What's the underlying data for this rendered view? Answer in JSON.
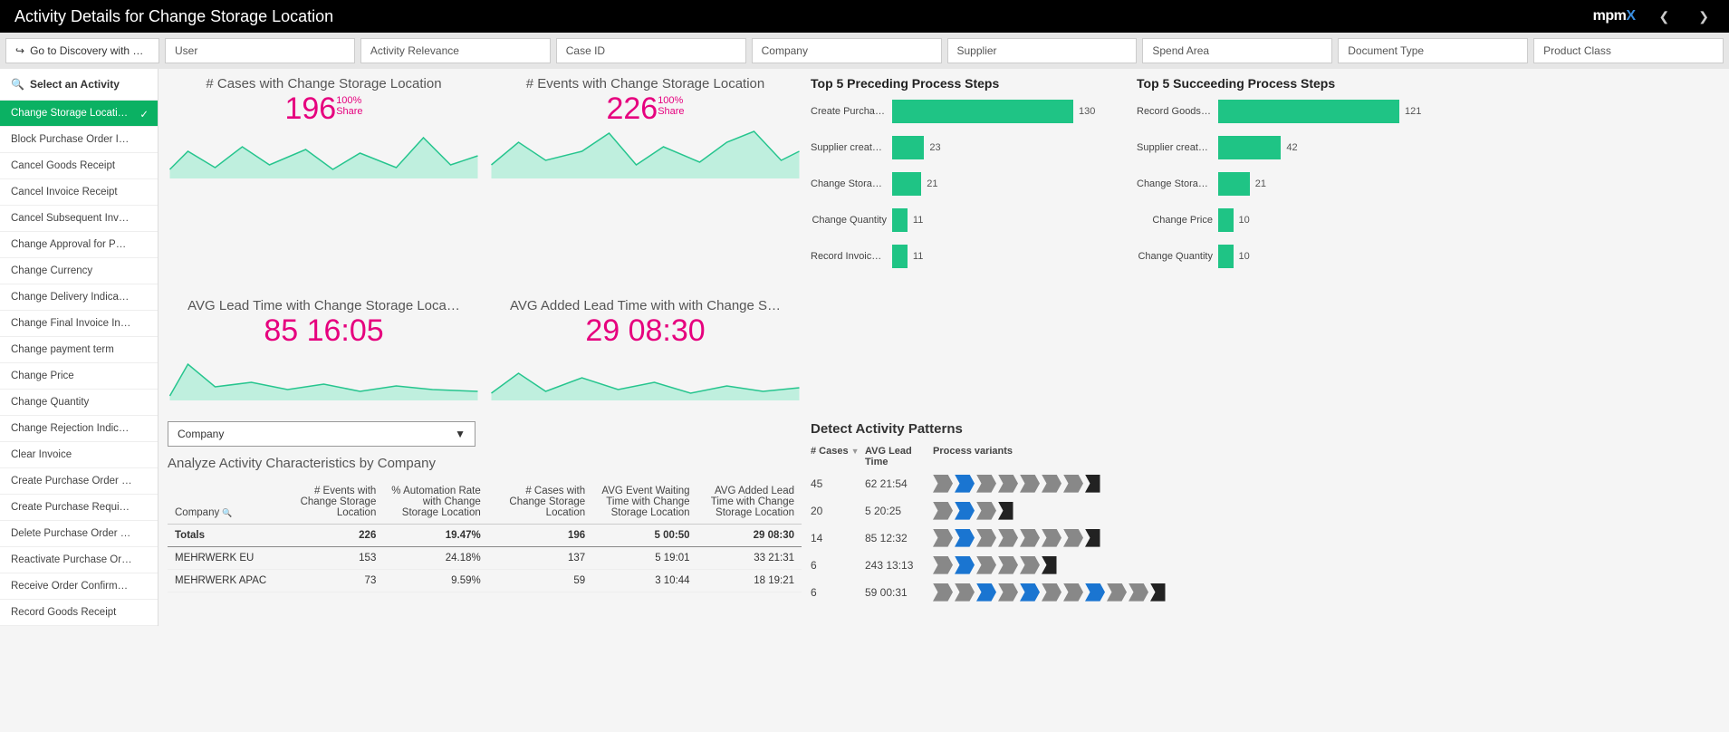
{
  "header": {
    "title": "Activity Details for Change Storage Location",
    "logo_prefix": "mpm",
    "logo_suffix": "X"
  },
  "filters": {
    "discovery": "Go to Discovery with …",
    "items": [
      "User",
      "Activity Relevance",
      "Case ID",
      "Company",
      "Supplier",
      "Spend Area",
      "Document Type",
      "Product Class"
    ]
  },
  "sidebar": {
    "title": "Select an Activity",
    "items": [
      "Change Storage Locati…",
      "Block Purchase Order I…",
      "Cancel Goods Receipt",
      "Cancel Invoice Receipt",
      "Cancel Subsequent Inv…",
      "Change Approval for P…",
      "Change Currency",
      "Change Delivery Indica…",
      "Change Final Invoice In…",
      "Change payment term",
      "Change Price",
      "Change Quantity",
      "Change Rejection Indic…",
      "Clear Invoice",
      "Create Purchase Order …",
      "Create Purchase Requi…",
      "Delete Purchase Order …",
      "Reactivate Purchase Or…",
      "Receive Order Confirm…",
      "Record Goods Receipt"
    ],
    "selected_index": 0
  },
  "kpis": [
    {
      "title": "# Cases with Change Storage Location",
      "value": "196",
      "pct": "100%",
      "sub": "Share"
    },
    {
      "title": "# Events with Change Storage Location",
      "value": "226",
      "pct": "100%",
      "sub": "Share"
    },
    {
      "title": "AVG Lead Time with Change Storage Loca…",
      "value": "85 16:05"
    },
    {
      "title": "AVG Added Lead Time with with Change S…",
      "value": "29 08:30"
    }
  ],
  "top_preceding": {
    "title": "Top 5 Preceding Process Steps",
    "max": 130,
    "items": [
      {
        "label": "Create Purchas…",
        "value": 130
      },
      {
        "label": "Supplier creates…",
        "value": 23
      },
      {
        "label": "Change Storage…",
        "value": 21
      },
      {
        "label": "Change Quantity",
        "value": 11
      },
      {
        "label": "Record Invoice …",
        "value": 11
      }
    ]
  },
  "top_succeeding": {
    "title": "Top 5 Succeeding Process Steps",
    "max": 121,
    "items": [
      {
        "label": "Record Goods R…",
        "value": 121
      },
      {
        "label": "Supplier creates…",
        "value": 42
      },
      {
        "label": "Change Storage…",
        "value": 21
      },
      {
        "label": "Change Price",
        "value": 10
      },
      {
        "label": "Change Quantity",
        "value": 10
      }
    ]
  },
  "analyze": {
    "selector": "Company",
    "title": "Analyze Activity Characteristics by Company",
    "headers": [
      "Company",
      "# Events with Change Storage Location",
      "% Automation Rate with Change Storage Location",
      "# Cases with Change Storage Location",
      "AVG Event Waiting Time with Change Storage Location",
      "AVG Added Lead Time with Change Storage Location"
    ],
    "totals": [
      "Totals",
      "226",
      "19.47%",
      "196",
      "5 00:50",
      "29 08:30"
    ],
    "rows": [
      [
        "MEHRWERK EU",
        "153",
        "24.18%",
        "137",
        "5 19:01",
        "33 21:31"
      ],
      [
        "MEHRWERK APAC",
        "73",
        "9.59%",
        "59",
        "3 10:44",
        "18 19:21"
      ]
    ]
  },
  "patterns": {
    "title": "Detect Activity Patterns",
    "headers": [
      "# Cases",
      "AVG Lead Time",
      "Process variants"
    ],
    "rows": [
      {
        "cases": "45",
        "lead": "62 21:54",
        "chev": [
          "g",
          "b",
          "g",
          "g",
          "g",
          "g",
          "g",
          "e"
        ]
      },
      {
        "cases": "20",
        "lead": "5 20:25",
        "chev": [
          "g",
          "b",
          "g",
          "e"
        ]
      },
      {
        "cases": "14",
        "lead": "85 12:32",
        "chev": [
          "g",
          "b",
          "g",
          "g",
          "g",
          "g",
          "g",
          "e"
        ]
      },
      {
        "cases": "6",
        "lead": "243 13:13",
        "chev": [
          "g",
          "b",
          "g",
          "g",
          "g",
          "e"
        ]
      },
      {
        "cases": "6",
        "lead": "59 00:31",
        "chev": [
          "g",
          "g",
          "b",
          "g",
          "b",
          "g",
          "g",
          "b",
          "g",
          "g",
          "e"
        ]
      }
    ]
  },
  "chart_data": [
    {
      "type": "bar",
      "title": "Top 5 Preceding Process Steps",
      "categories": [
        "Create Purchase Order Item",
        "Supplier creates invoice",
        "Change Storage Location",
        "Change Quantity",
        "Record Invoice Receipt"
      ],
      "values": [
        130,
        23,
        21,
        11,
        11
      ],
      "orientation": "horizontal"
    },
    {
      "type": "bar",
      "title": "Top 5 Succeeding Process Steps",
      "categories": [
        "Record Goods Receipt",
        "Supplier creates invoice",
        "Change Storage Location",
        "Change Price",
        "Change Quantity"
      ],
      "values": [
        121,
        42,
        21,
        10,
        10
      ],
      "orientation": "horizontal"
    },
    {
      "type": "area",
      "title": "# Cases with Change Storage Location",
      "value": 196,
      "share_pct": 100
    },
    {
      "type": "area",
      "title": "# Events with Change Storage Location",
      "value": 226,
      "share_pct": 100
    },
    {
      "type": "area",
      "title": "AVG Lead Time with Change Storage Location",
      "value": "85 16:05"
    },
    {
      "type": "area",
      "title": "AVG Added Lead Time with Change Storage Location",
      "value": "29 08:30"
    },
    {
      "type": "table",
      "title": "Analyze Activity Characteristics by Company",
      "columns": [
        "Company",
        "# Events",
        "% Automation Rate",
        "# Cases",
        "AVG Event Waiting Time",
        "AVG Added Lead Time"
      ],
      "rows": [
        [
          "Totals",
          226,
          "19.47%",
          196,
          "5 00:50",
          "29 08:30"
        ],
        [
          "MEHRWERK EU",
          153,
          "24.18%",
          137,
          "5 19:01",
          "33 21:31"
        ],
        [
          "MEHRWERK APAC",
          73,
          "9.59%",
          59,
          "3 10:44",
          "18 19:21"
        ]
      ]
    }
  ]
}
